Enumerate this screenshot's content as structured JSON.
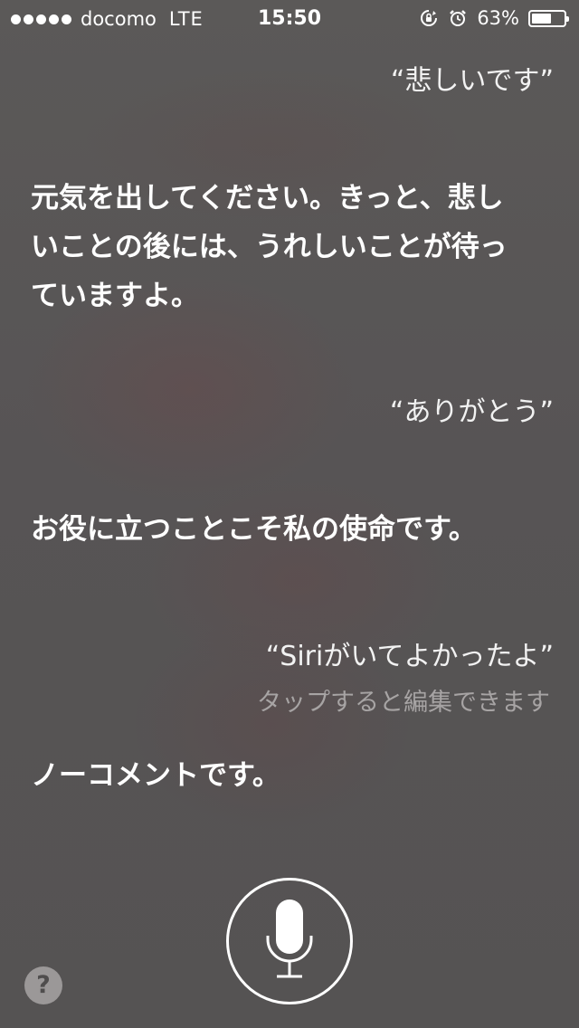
{
  "status_bar": {
    "carrier": "docomo",
    "network": "LTE",
    "time": "15:50",
    "battery_percent": "63%",
    "battery_level": 0.63,
    "signal_bars": 5,
    "icons": [
      "rotation-lock-icon",
      "alarm-icon",
      "battery-icon"
    ]
  },
  "conversation": [
    {
      "speaker": "user",
      "text": "“悲しいです”"
    },
    {
      "speaker": "siri",
      "text": "元気を出してください。きっと、悲しいことの後には、うれしいことが待っていますよ。"
    },
    {
      "speaker": "user",
      "text": "“ありがとう”"
    },
    {
      "speaker": "siri",
      "text": "お役に立つことこそ私の使命です。"
    },
    {
      "speaker": "user",
      "text": "“Siriがいてよかったよ”",
      "hint": "タップすると編集できます"
    },
    {
      "speaker": "siri",
      "text": "ノーコメントです。"
    }
  ],
  "controls": {
    "help_label": "?",
    "mic_icon": "microphone-icon"
  },
  "colors": {
    "background": "#575555",
    "text": "#ffffff",
    "hint": "#a7a4a4",
    "help_button": "#9b9898"
  }
}
